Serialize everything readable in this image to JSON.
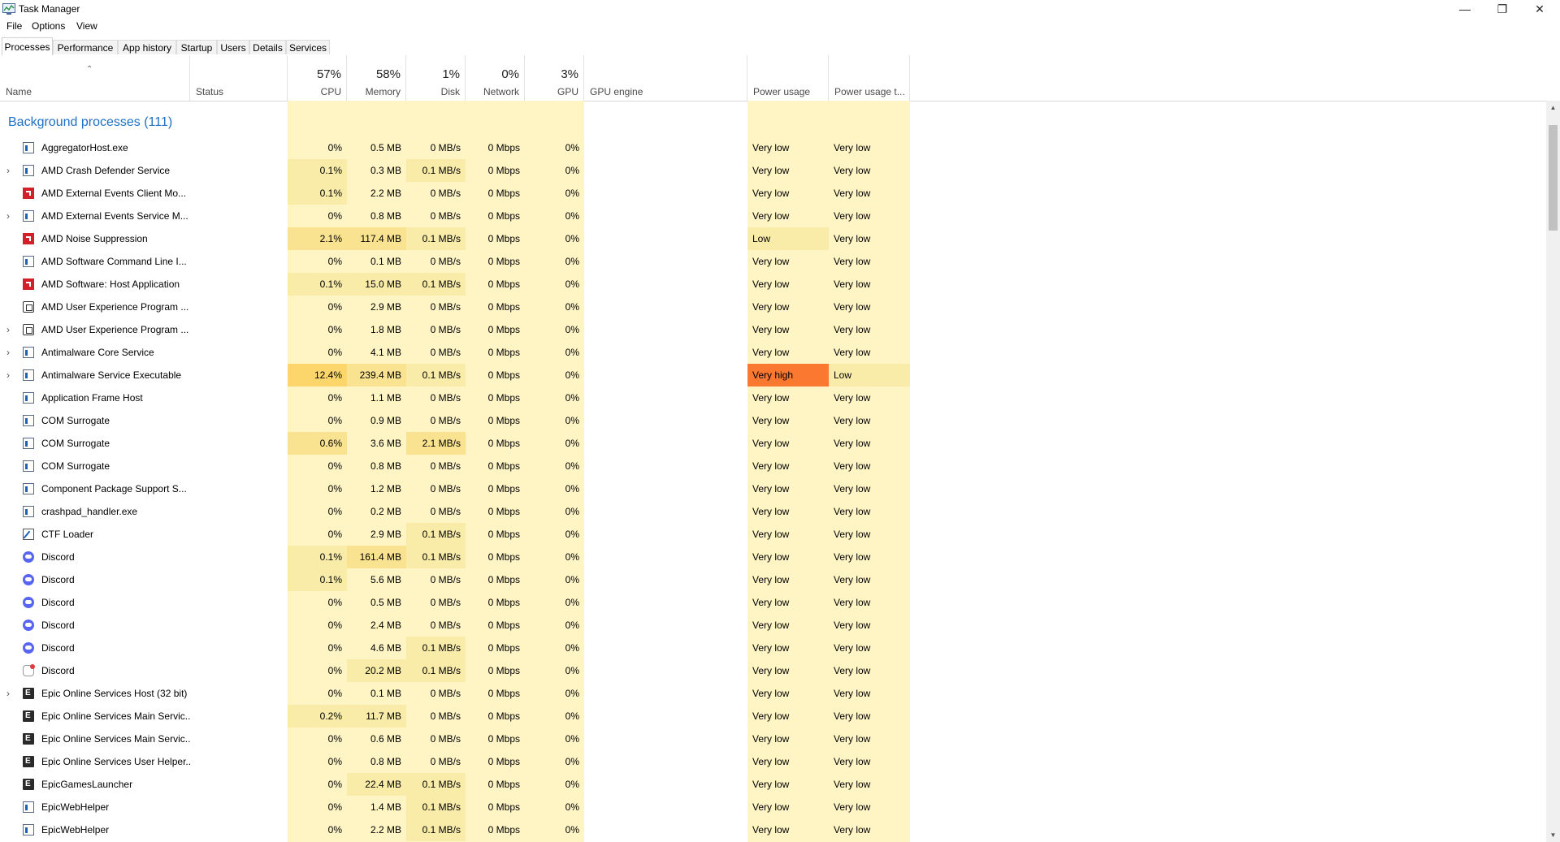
{
  "window": {
    "title": "Task Manager",
    "minimize_icon": "minimize-icon",
    "restore_icon": "restore-icon",
    "close_icon": "close-icon"
  },
  "menu": [
    "File",
    "Options",
    "View"
  ],
  "tabs": [
    {
      "label": "Processes",
      "active": true
    },
    {
      "label": "Performance",
      "active": false
    },
    {
      "label": "App history",
      "active": false
    },
    {
      "label": "Startup",
      "active": false
    },
    {
      "label": "Users",
      "active": false
    },
    {
      "label": "Details",
      "active": false
    },
    {
      "label": "Services",
      "active": false
    }
  ],
  "columns": {
    "name": {
      "label": "Name"
    },
    "status": {
      "label": "Status"
    },
    "cpu": {
      "label": "CPU",
      "percent": "57%"
    },
    "memory": {
      "label": "Memory",
      "percent": "58%"
    },
    "disk": {
      "label": "Disk",
      "percent": "1%"
    },
    "network": {
      "label": "Network",
      "percent": "0%"
    },
    "gpu": {
      "label": "GPU",
      "percent": "3%"
    },
    "gpu_engine": {
      "label": "GPU engine"
    },
    "power": {
      "label": "Power usage"
    },
    "power_trend": {
      "label": "Power usage t..."
    }
  },
  "group": {
    "label": "Background processes (111)"
  },
  "colors": {
    "heat_low": "#fff4c4",
    "heat_mid": "#f9eca8",
    "heat_high": "#f9e290",
    "heat_hot": "#fdd66b",
    "power_very_high": "#fa7830",
    "link_blue": "#1f6fc5"
  },
  "processes": [
    {
      "name": "AggregatorHost.exe",
      "icon": "window",
      "expandable": false,
      "cpu": "0%",
      "memory": "0.5 MB",
      "disk": "0 MB/s",
      "network": "0 Mbps",
      "gpu": "0%",
      "power": "Very low",
      "power_trend": "Very low"
    },
    {
      "name": "AMD Crash Defender Service",
      "icon": "window",
      "expandable": true,
      "cpu": "0.1%",
      "memory": "0.3 MB",
      "disk": "0.1 MB/s",
      "network": "0 Mbps",
      "gpu": "0%",
      "power": "Very low",
      "power_trend": "Very low"
    },
    {
      "name": "AMD External Events Client Mo...",
      "icon": "amd",
      "expandable": false,
      "cpu": "0.1%",
      "memory": "2.2 MB",
      "disk": "0 MB/s",
      "network": "0 Mbps",
      "gpu": "0%",
      "power": "Very low",
      "power_trend": "Very low"
    },
    {
      "name": "AMD External Events Service M...",
      "icon": "window",
      "expandable": true,
      "cpu": "0%",
      "memory": "0.8 MB",
      "disk": "0 MB/s",
      "network": "0 Mbps",
      "gpu": "0%",
      "power": "Very low",
      "power_trend": "Very low"
    },
    {
      "name": "AMD Noise Suppression",
      "icon": "amd",
      "expandable": false,
      "cpu": "2.1%",
      "memory": "117.4 MB",
      "disk": "0.1 MB/s",
      "network": "0 Mbps",
      "gpu": "0%",
      "power": "Low",
      "power_trend": "Very low"
    },
    {
      "name": "AMD Software Command Line I...",
      "icon": "window",
      "expandable": false,
      "cpu": "0%",
      "memory": "0.1 MB",
      "disk": "0 MB/s",
      "network": "0 Mbps",
      "gpu": "0%",
      "power": "Very low",
      "power_trend": "Very low"
    },
    {
      "name": "AMD Software: Host Application",
      "icon": "amd",
      "expandable": false,
      "cpu": "0.1%",
      "memory": "15.0 MB",
      "disk": "0.1 MB/s",
      "network": "0 Mbps",
      "gpu": "0%",
      "power": "Very low",
      "power_trend": "Very low"
    },
    {
      "name": "AMD User Experience Program ...",
      "icon": "amd-ux",
      "expandable": false,
      "cpu": "0%",
      "memory": "2.9 MB",
      "disk": "0 MB/s",
      "network": "0 Mbps",
      "gpu": "0%",
      "power": "Very low",
      "power_trend": "Very low"
    },
    {
      "name": "AMD User Experience Program ...",
      "icon": "amd-ux",
      "expandable": true,
      "cpu": "0%",
      "memory": "1.8 MB",
      "disk": "0 MB/s",
      "network": "0 Mbps",
      "gpu": "0%",
      "power": "Very low",
      "power_trend": "Very low"
    },
    {
      "name": "Antimalware Core Service",
      "icon": "window",
      "expandable": true,
      "cpu": "0%",
      "memory": "4.1 MB",
      "disk": "0 MB/s",
      "network": "0 Mbps",
      "gpu": "0%",
      "power": "Very low",
      "power_trend": "Very low"
    },
    {
      "name": "Antimalware Service Executable",
      "icon": "window",
      "expandable": true,
      "cpu": "12.4%",
      "memory": "239.4 MB",
      "disk": "0.1 MB/s",
      "network": "0 Mbps",
      "gpu": "0%",
      "power": "Very high",
      "power_trend": "Low"
    },
    {
      "name": "Application Frame Host",
      "icon": "window",
      "expandable": false,
      "cpu": "0%",
      "memory": "1.1 MB",
      "disk": "0 MB/s",
      "network": "0 Mbps",
      "gpu": "0%",
      "power": "Very low",
      "power_trend": "Very low"
    },
    {
      "name": "COM Surrogate",
      "icon": "window",
      "expandable": false,
      "cpu": "0%",
      "memory": "0.9 MB",
      "disk": "0 MB/s",
      "network": "0 Mbps",
      "gpu": "0%",
      "power": "Very low",
      "power_trend": "Very low"
    },
    {
      "name": "COM Surrogate",
      "icon": "window",
      "expandable": false,
      "cpu": "0.6%",
      "memory": "3.6 MB",
      "disk": "2.1 MB/s",
      "network": "0 Mbps",
      "gpu": "0%",
      "power": "Very low",
      "power_trend": "Very low"
    },
    {
      "name": "COM Surrogate",
      "icon": "window",
      "expandable": false,
      "cpu": "0%",
      "memory": "0.8 MB",
      "disk": "0 MB/s",
      "network": "0 Mbps",
      "gpu": "0%",
      "power": "Very low",
      "power_trend": "Very low"
    },
    {
      "name": "Component Package Support S...",
      "icon": "window",
      "expandable": false,
      "cpu": "0%",
      "memory": "1.2 MB",
      "disk": "0 MB/s",
      "network": "0 Mbps",
      "gpu": "0%",
      "power": "Very low",
      "power_trend": "Very low"
    },
    {
      "name": "crashpad_handler.exe",
      "icon": "window",
      "expandable": false,
      "cpu": "0%",
      "memory": "0.2 MB",
      "disk": "0 MB/s",
      "network": "0 Mbps",
      "gpu": "0%",
      "power": "Very low",
      "power_trend": "Very low"
    },
    {
      "name": "CTF Loader",
      "icon": "ctf",
      "expandable": false,
      "cpu": "0%",
      "memory": "2.9 MB",
      "disk": "0.1 MB/s",
      "network": "0 Mbps",
      "gpu": "0%",
      "power": "Very low",
      "power_trend": "Very low"
    },
    {
      "name": "Discord",
      "icon": "discord",
      "expandable": false,
      "cpu": "0.1%",
      "memory": "161.4 MB",
      "disk": "0.1 MB/s",
      "network": "0 Mbps",
      "gpu": "0%",
      "power": "Very low",
      "power_trend": "Very low"
    },
    {
      "name": "Discord",
      "icon": "discord",
      "expandable": false,
      "cpu": "0.1%",
      "memory": "5.6 MB",
      "disk": "0 MB/s",
      "network": "0 Mbps",
      "gpu": "0%",
      "power": "Very low",
      "power_trend": "Very low"
    },
    {
      "name": "Discord",
      "icon": "discord",
      "expandable": false,
      "cpu": "0%",
      "memory": "0.5 MB",
      "disk": "0 MB/s",
      "network": "0 Mbps",
      "gpu": "0%",
      "power": "Very low",
      "power_trend": "Very low"
    },
    {
      "name": "Discord",
      "icon": "discord",
      "expandable": false,
      "cpu": "0%",
      "memory": "2.4 MB",
      "disk": "0 MB/s",
      "network": "0 Mbps",
      "gpu": "0%",
      "power": "Very low",
      "power_trend": "Very low"
    },
    {
      "name": "Discord",
      "icon": "discord",
      "expandable": false,
      "cpu": "0%",
      "memory": "4.6 MB",
      "disk": "0.1 MB/s",
      "network": "0 Mbps",
      "gpu": "0%",
      "power": "Very low",
      "power_trend": "Very low"
    },
    {
      "name": "Discord",
      "icon": "discord-alt",
      "expandable": false,
      "cpu": "0%",
      "memory": "20.2 MB",
      "disk": "0.1 MB/s",
      "network": "0 Mbps",
      "gpu": "0%",
      "power": "Very low",
      "power_trend": "Very low"
    },
    {
      "name": "Epic Online Services Host (32 bit)",
      "icon": "epic",
      "expandable": true,
      "cpu": "0%",
      "memory": "0.1 MB",
      "disk": "0 MB/s",
      "network": "0 Mbps",
      "gpu": "0%",
      "power": "Very low",
      "power_trend": "Very low"
    },
    {
      "name": "Epic Online Services Main Servic...",
      "icon": "epic",
      "expandable": false,
      "cpu": "0.2%",
      "memory": "11.7 MB",
      "disk": "0 MB/s",
      "network": "0 Mbps",
      "gpu": "0%",
      "power": "Very low",
      "power_trend": "Very low"
    },
    {
      "name": "Epic Online Services Main Servic...",
      "icon": "epic",
      "expandable": false,
      "cpu": "0%",
      "memory": "0.6 MB",
      "disk": "0 MB/s",
      "network": "0 Mbps",
      "gpu": "0%",
      "power": "Very low",
      "power_trend": "Very low"
    },
    {
      "name": "Epic Online Services User Helper...",
      "icon": "epic",
      "expandable": false,
      "cpu": "0%",
      "memory": "0.8 MB",
      "disk": "0 MB/s",
      "network": "0 Mbps",
      "gpu": "0%",
      "power": "Very low",
      "power_trend": "Very low"
    },
    {
      "name": "EpicGamesLauncher",
      "icon": "epic",
      "expandable": false,
      "cpu": "0%",
      "memory": "22.4 MB",
      "disk": "0.1 MB/s",
      "network": "0 Mbps",
      "gpu": "0%",
      "power": "Very low",
      "power_trend": "Very low"
    },
    {
      "name": "EpicWebHelper",
      "icon": "window",
      "expandable": false,
      "cpu": "0%",
      "memory": "1.4 MB",
      "disk": "0.1 MB/s",
      "network": "0 Mbps",
      "gpu": "0%",
      "power": "Very low",
      "power_trend": "Very low"
    },
    {
      "name": "EpicWebHelper",
      "icon": "window",
      "expandable": false,
      "cpu": "0%",
      "memory": "2.2 MB",
      "disk": "0.1 MB/s",
      "network": "0 Mbps",
      "gpu": "0%",
      "power": "Very low",
      "power_trend": "Very low"
    }
  ]
}
